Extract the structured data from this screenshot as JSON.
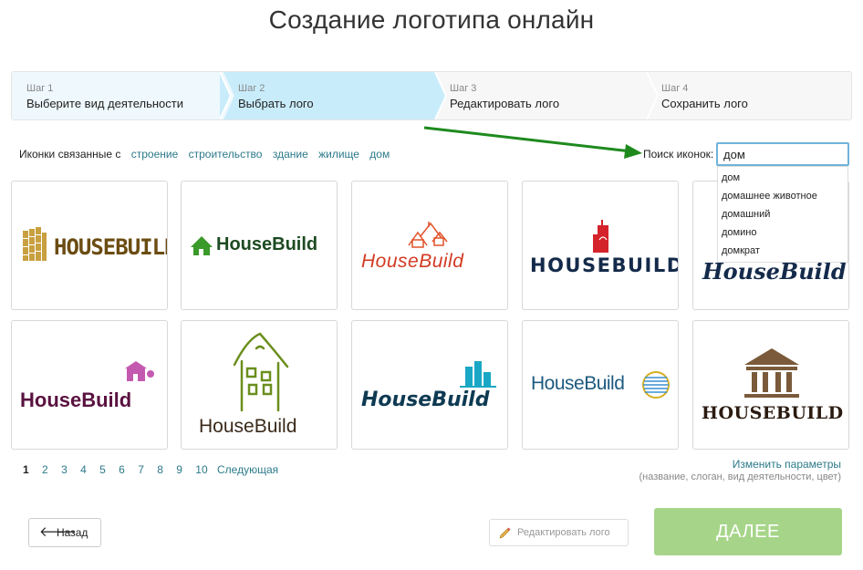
{
  "page": {
    "title": "Создание логотипа онлайн"
  },
  "steps": [
    {
      "num": "Шаг 1",
      "label": "Выберите вид деятельности"
    },
    {
      "num": "Шаг 2",
      "label": "Выбрать лого"
    },
    {
      "num": "Шаг 3",
      "label": "Редактировать лого"
    },
    {
      "num": "Шаг 4",
      "label": "Сохранить лого"
    }
  ],
  "related": {
    "prefix": "Иконки связанные с",
    "tags": [
      "строение",
      "строительство",
      "здание",
      "жилище",
      "дом"
    ]
  },
  "search": {
    "label": "Поиск иконок:",
    "value": "дом",
    "suggestions": [
      "дом",
      "домашнее животное",
      "домашний",
      "домино",
      "домкрат"
    ]
  },
  "logos": {
    "l1": "HOUSEBUILD",
    "l2": "HouseBuild",
    "l3": "HouseBuild",
    "l4": "HOUSEBUILD",
    "l5": "HouseBuild",
    "l6": "HouseBuild",
    "l7": "HouseBuild",
    "l8": "HouseBuild",
    "l9": "HouseBuild",
    "l10": "HOUSEBUILD"
  },
  "pagination": {
    "pages": [
      "1",
      "2",
      "3",
      "4",
      "5",
      "6",
      "7",
      "8",
      "9",
      "10"
    ],
    "current": "1",
    "next_label": "Следующая"
  },
  "params": {
    "link": "Изменить параметры",
    "hint": "(название, слоган, вид деятельности, цвет)"
  },
  "buttons": {
    "back": "Назад",
    "edit": "Редактировать лого",
    "next": "ДАЛЕЕ"
  },
  "colors": {
    "step_active": "#c9ecfb",
    "link": "#2c7a8a",
    "next_button": "#a6d589",
    "annotation_arrow": "#1e8a1e"
  }
}
